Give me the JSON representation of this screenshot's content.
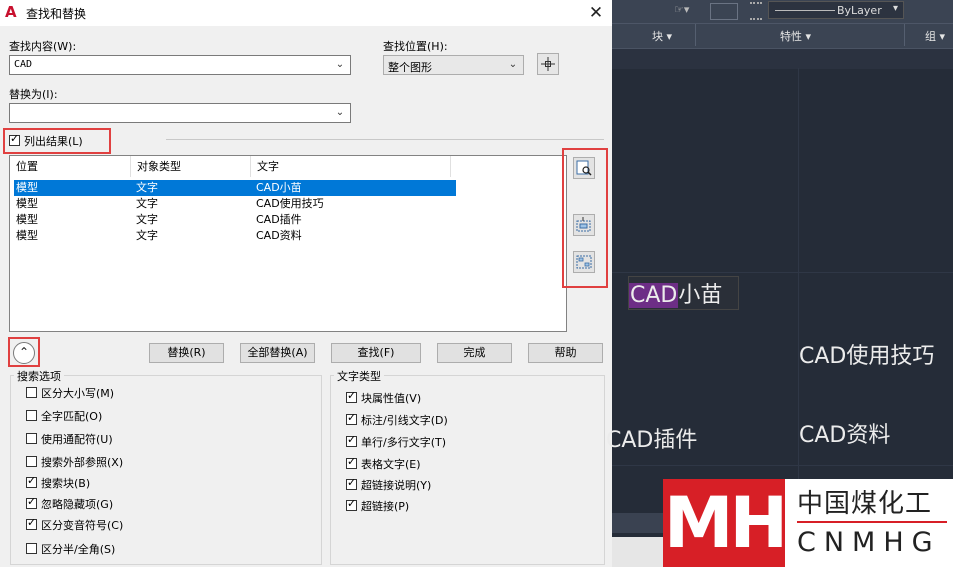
{
  "dialog": {
    "title": "查找和替换",
    "app_icon": "A",
    "close": "✕",
    "find_what": {
      "label": "查找内容(W):",
      "value": "CAD"
    },
    "find_where": {
      "label": "查找位置(H):",
      "value": "整个图形"
    },
    "replace_with": {
      "label": "替换为(I):",
      "value": ""
    },
    "list_results": {
      "label": "列出结果(L)",
      "checked": true
    },
    "results": {
      "headers": [
        "位置",
        "对象类型",
        "文字"
      ],
      "rows": [
        [
          "模型",
          "文字",
          "CAD小苗"
        ],
        [
          "模型",
          "文字",
          "CAD使用技巧"
        ],
        [
          "模型",
          "文字",
          "CAD插件"
        ],
        [
          "模型",
          "文字",
          "CAD资料"
        ]
      ],
      "selected_row": 0
    },
    "side_icons": [
      "zoom-to-selected-icon",
      "create-selection-set-icon",
      "create-selection-set-all-icon"
    ],
    "buttons": {
      "replace": "替换(R)",
      "replace_all": "全部替换(A)",
      "find": "查找(F)",
      "done": "完成",
      "help": "帮助"
    },
    "search_options": {
      "title": "搜索选项",
      "items": [
        {
          "label": "区分大小写(M)",
          "checked": false
        },
        {
          "label": "全字匹配(O)",
          "checked": false
        },
        {
          "label": "使用通配符(U)",
          "checked": false
        },
        {
          "label": "搜索外部参照(X)",
          "checked": false
        },
        {
          "label": "搜索块(B)",
          "checked": true
        },
        {
          "label": "忽略隐藏项(G)",
          "checked": true
        },
        {
          "label": "区分变音符号(C)",
          "checked": true
        },
        {
          "label": "区分半/全角(S)",
          "checked": false
        }
      ]
    },
    "text_types": {
      "title": "文字类型",
      "items": [
        {
          "label": "块属性值(V)",
          "checked": true
        },
        {
          "label": "标注/引线文字(D)",
          "checked": true
        },
        {
          "label": "单行/多行文字(T)",
          "checked": true
        },
        {
          "label": "表格文字(E)",
          "checked": true
        },
        {
          "label": "超链接说明(Y)",
          "checked": true
        },
        {
          "label": "超链接(P)",
          "checked": true
        }
      ]
    }
  },
  "cad": {
    "ribbon": {
      "bylayer": "ByLayer",
      "panels": [
        "块 ▾",
        "特性 ▾",
        "组 ▾"
      ]
    },
    "texts": [
      "CAD",
      "小苗",
      "CAD使用技巧",
      "CAD插件",
      "CAD资料"
    ]
  },
  "watermark": {
    "mark": "MH",
    "cn": "中国煤化工",
    "en": "CNMHG"
  },
  "colors": {
    "selection": "#0078d7",
    "highlight_box": "#e04040",
    "cad_background": "#252c38",
    "logo_red": "#d71f26"
  }
}
